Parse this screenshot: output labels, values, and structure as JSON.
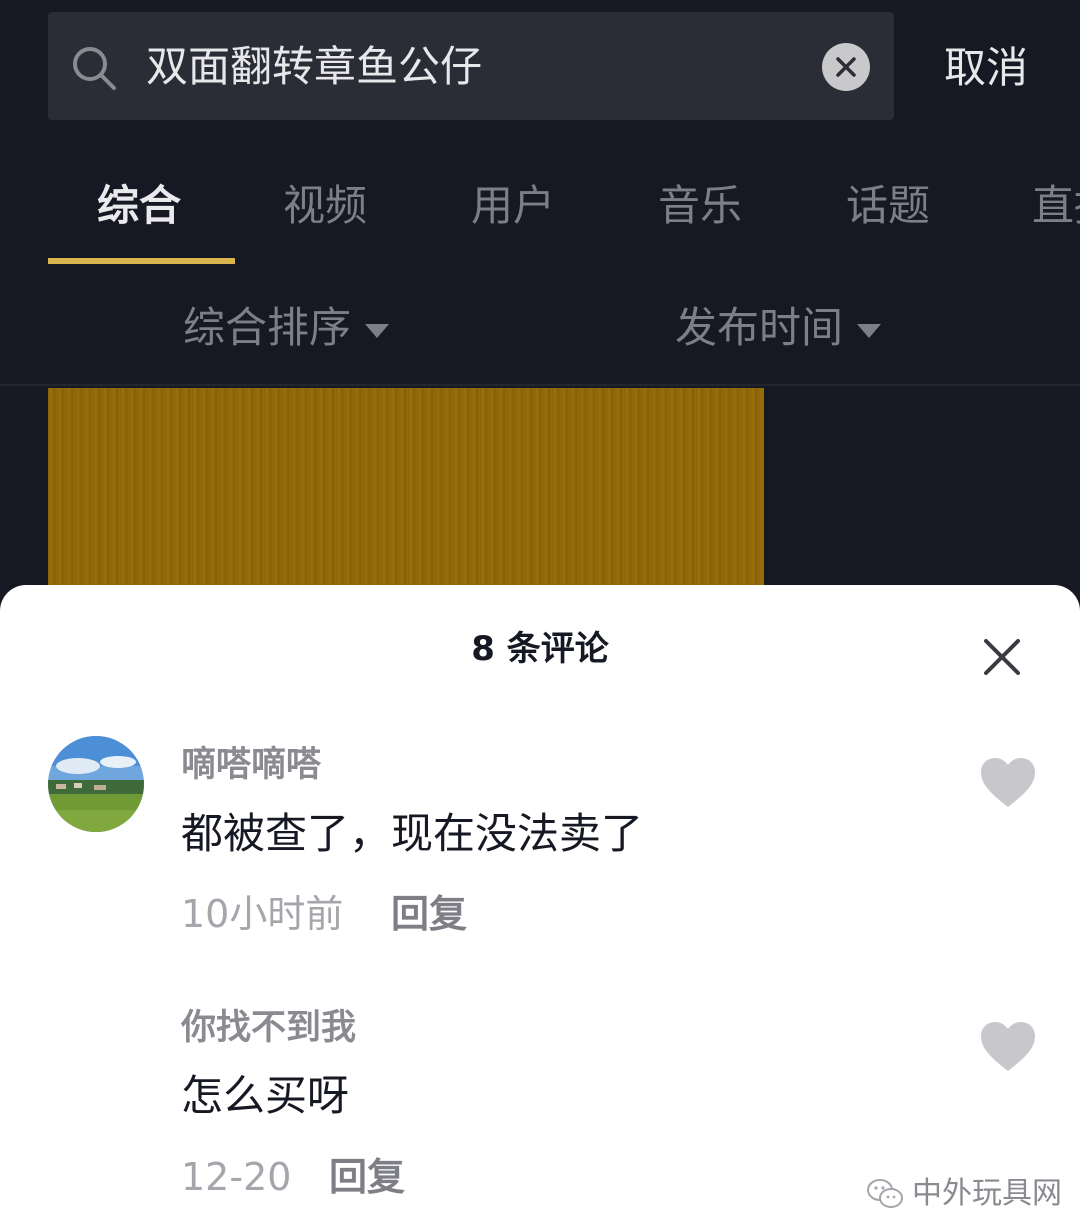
{
  "search": {
    "query": "双面翻转章鱼公仔",
    "cancel_label": "取消"
  },
  "tabs": [
    {
      "label": "综合",
      "active": true
    },
    {
      "label": "视频",
      "active": false
    },
    {
      "label": "用户",
      "active": false
    },
    {
      "label": "音乐",
      "active": false
    },
    {
      "label": "话题",
      "active": false
    },
    {
      "label": "直播",
      "active": false
    }
  ],
  "filters": {
    "sort_label": "综合排序",
    "time_label": "发布时间"
  },
  "comments_sheet": {
    "title": "8 条评论",
    "comments": [
      {
        "username": "嘀嗒嘀嗒",
        "text": "都被查了，现在没法卖了",
        "time": "10小时前",
        "reply_label": "回复"
      },
      {
        "username": "你找不到我",
        "text": "怎么买呀",
        "time": "12-20",
        "reply_label": "回复"
      }
    ]
  },
  "watermark": {
    "text": "中外玩具网"
  },
  "colors": {
    "background": "#161823",
    "accent_underline": "#d8b44a",
    "thumbnail": "#8d6506",
    "sheet": "#ffffff"
  }
}
